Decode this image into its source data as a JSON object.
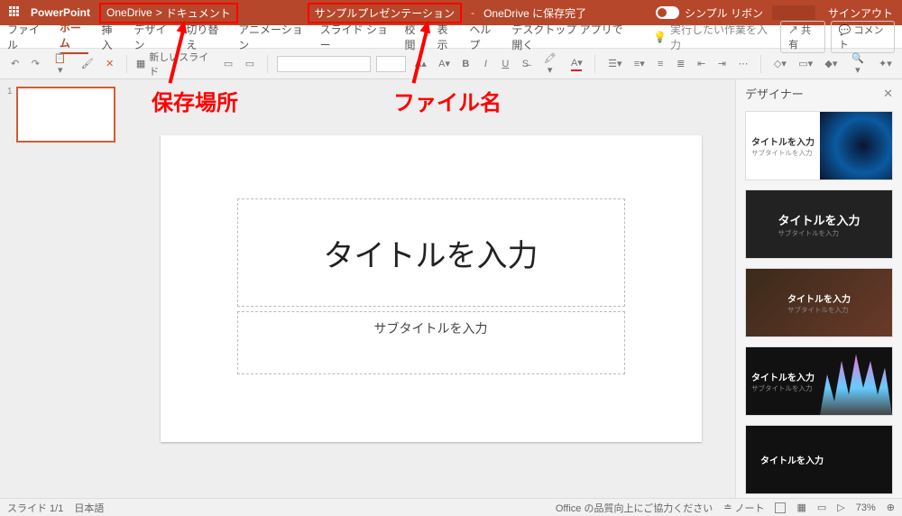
{
  "titlebar": {
    "app": "PowerPoint",
    "breadcrumb1": "OneDrive",
    "breadcrumb_sep": ">",
    "breadcrumb2": "ドキュメント",
    "filename": "サンプルプレゼンテーション",
    "dash": "-",
    "save_status": "OneDrive に保存完了",
    "ribbon_mode": "シンプル リボン",
    "signout": "サインアウト"
  },
  "tabs": {
    "file": "ファイル",
    "home": "ホーム",
    "insert": "挿入",
    "design": "デザイン",
    "transitions": "切り替え",
    "animations": "アニメーション",
    "slideshow": "スライド ショー",
    "review": "校閲",
    "view": "表示",
    "help": "ヘルプ",
    "desktop": "デスクトップ アプリで開く",
    "tellme": "実行したい作業を入力",
    "share": "共有",
    "comments": "コメント"
  },
  "toolbar": {
    "new_slide": "新しいスライド"
  },
  "slide": {
    "title_placeholder": "タイトルを入力",
    "subtitle_placeholder": "サブタイトルを入力"
  },
  "designer": {
    "title": "デザイナー",
    "item_title": "タイトルを入力",
    "item_sub": "サブタイトルを入力"
  },
  "annotations": {
    "location": "保存場所",
    "filename": "ファイル名"
  },
  "status": {
    "slide_num": "スライド 1/1",
    "lang": "日本語",
    "quality": "Office の品質向上にご協力ください",
    "notes": "ノート",
    "zoom": "73%"
  },
  "thumb": {
    "num": "1"
  }
}
